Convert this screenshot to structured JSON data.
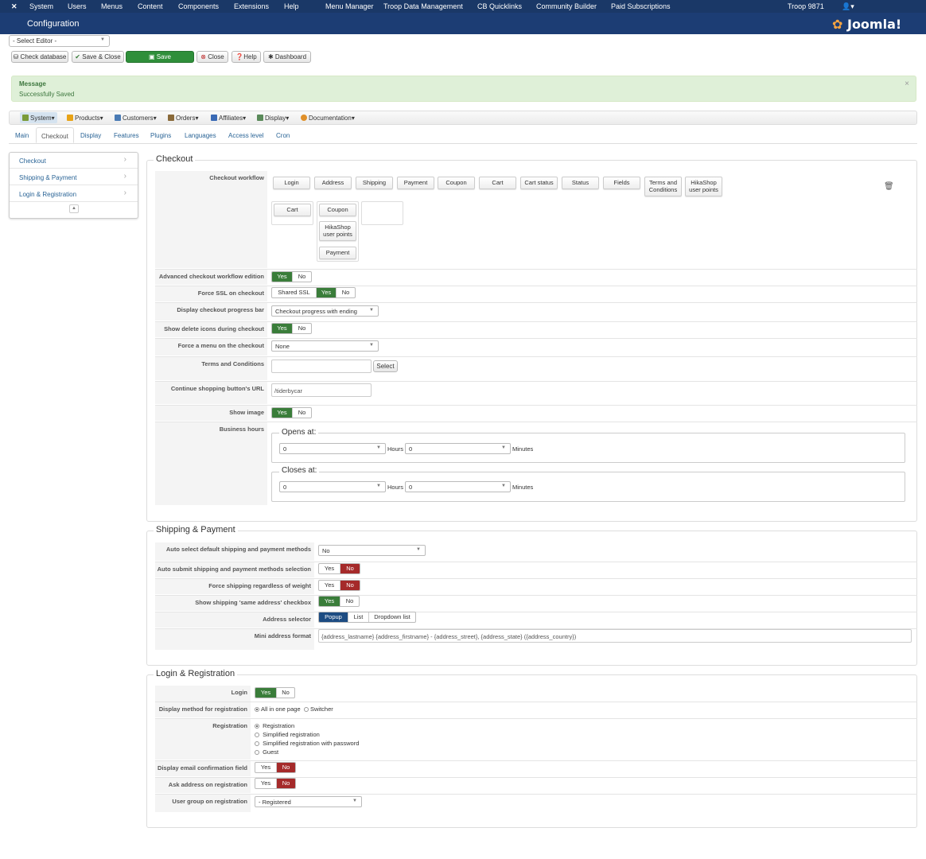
{
  "topnav": {
    "items": [
      "System",
      "Users",
      "Menus",
      "Content",
      "Components",
      "Extensions",
      "Help",
      "Menu Manager",
      "Troop Data Management",
      "CB Quicklinks",
      "Community Builder",
      "Paid Subscriptions"
    ],
    "site": "Troop 9871"
  },
  "title": "Configuration",
  "brand": "Joomla!",
  "editor_select": "- Select Editor -",
  "toolbar": {
    "check_db": "Check database",
    "save_close": "Save & Close",
    "save": "Save",
    "close": "Close",
    "help": "Help",
    "dashboard": "Dashboard"
  },
  "message": {
    "heading": "Message",
    "text": "Successfully Saved",
    "close": "×"
  },
  "hika_menu": [
    "System",
    "Products",
    "Customers",
    "Orders",
    "Affiliates",
    "Display",
    "Documentation"
  ],
  "tabs": [
    "Main",
    "Checkout",
    "Display",
    "Features",
    "Plugins",
    "Languages",
    "Access level",
    "Cron"
  ],
  "sidebar": [
    "Checkout",
    "Shipping & Payment",
    "Login & Registration"
  ],
  "checkout": {
    "legend": "Checkout",
    "labels": {
      "workflow": "Checkout workflow",
      "advanced": "Advanced checkout workflow edition",
      "ssl": "Force SSL on checkout",
      "progress": "Display checkout progress bar",
      "delete_icons": "Show delete icons during checkout",
      "force_menu": "Force a menu on the checkout",
      "terms": "Terms and Conditions",
      "continue_url": "Continue shopping button's URL",
      "show_image": "Show image",
      "business": "Business hours"
    },
    "workflow_items": [
      "Login",
      "Address",
      "Shipping",
      "Payment",
      "Coupon",
      "Cart",
      "Cart status",
      "Status",
      "Fields",
      "Terms and Conditions",
      "HikaShop user points"
    ],
    "step1": [
      "Cart"
    ],
    "step2": [
      "Coupon",
      "HikaShop user points",
      "Payment"
    ],
    "shared_ssl": "Shared SSL",
    "yes": "Yes",
    "no": "No",
    "progress_value": "Checkout progress with ending",
    "force_menu_value": "None",
    "select_btn": "Select",
    "continue_url_value": "/tiderbycar",
    "opens": "Opens at:",
    "closes": "Closes at:",
    "hours": "Hours",
    "minutes": "Minutes",
    "zero": "0"
  },
  "shipping": {
    "legend": "Shipping & Payment",
    "labels": {
      "auto_select": "Auto select default shipping and payment methods",
      "auto_submit": "Auto submit shipping and payment methods selection",
      "force_ship": "Force shipping regardless of weight",
      "same_addr": "Show shipping 'same address' checkbox",
      "addr_sel": "Address selector",
      "mini_fmt": "Mini address format"
    },
    "auto_select_value": "No",
    "addr_opts": [
      "Popup",
      "List",
      "Dropdown list"
    ],
    "mini_fmt_value": "{address_lastname} {address_firstname} - {address_street}, {address_state} ({address_country})"
  },
  "login": {
    "legend": "Login & Registration",
    "labels": {
      "login": "Login",
      "display_method": "Display method for registration",
      "registration": "Registration",
      "email_conf": "Display email confirmation field",
      "ask_addr": "Ask address on registration",
      "user_group": "User group on registration"
    },
    "method_opts": [
      "All in one page",
      "Switcher"
    ],
    "reg_opts": [
      "Registration",
      "Simplified registration",
      "Simplified registration with password",
      "Guest"
    ],
    "user_group_value": "- Registered"
  },
  "colors": {
    "nav": "#1a3867",
    "green": "#3a7d3a",
    "red": "#a52a2a",
    "blue": "#1d4c82"
  }
}
